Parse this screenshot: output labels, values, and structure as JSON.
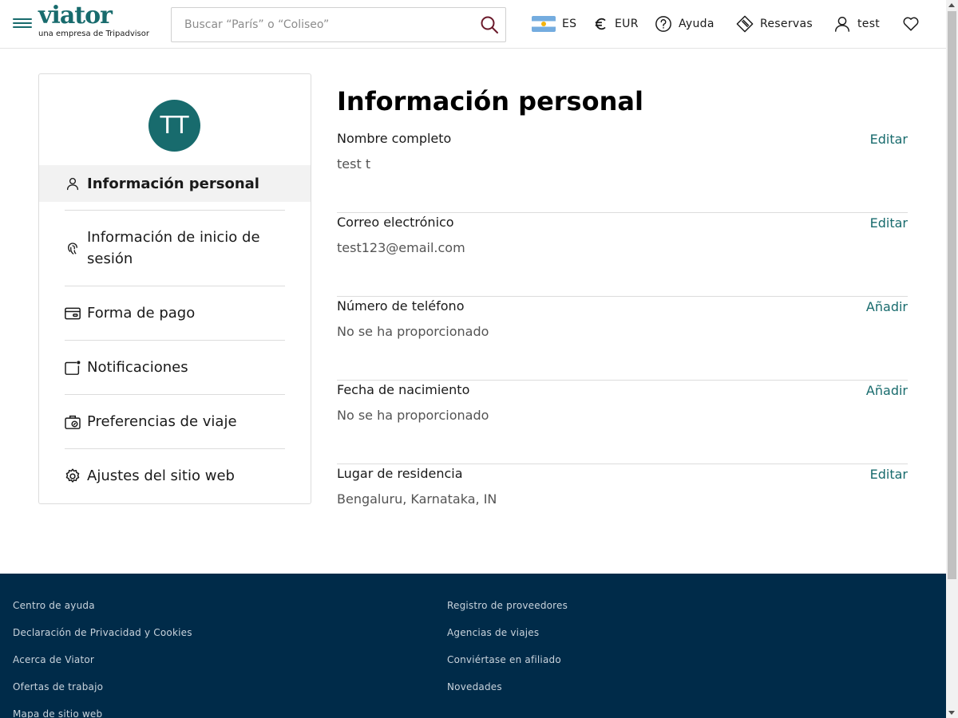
{
  "header": {
    "logo": "viator",
    "logo_sub": "una empresa de Tripadvisor",
    "search_placeholder": "Buscar “París” o “Coliseo”",
    "language": "ES",
    "currency": "EUR",
    "help": "Ayuda",
    "bookings": "Reservas",
    "user": "test"
  },
  "sidebar": {
    "avatar_initials": "TT",
    "items": [
      {
        "label": "Información personal",
        "icon": "person-icon"
      },
      {
        "label": "Información de inicio de sesión",
        "icon": "fingerprint-icon"
      },
      {
        "label": "Forma de pago",
        "icon": "credit-card-icon"
      },
      {
        "label": "Notificaciones",
        "icon": "notification-icon"
      },
      {
        "label": "Preferencias de viaje",
        "icon": "luggage-icon"
      },
      {
        "label": "Ajustes del sitio web",
        "icon": "gear-icon"
      }
    ]
  },
  "main": {
    "title": "Información personal",
    "fields": [
      {
        "label": "Nombre completo",
        "value": "test t",
        "action": "Editar"
      },
      {
        "label": "Correo electrónico",
        "value": "test123@email.com",
        "action": "Editar"
      },
      {
        "label": "Número de teléfono",
        "value": "No se ha proporcionado",
        "action": "Añadir"
      },
      {
        "label": "Fecha de nacimiento",
        "value": "No se ha proporcionado",
        "action": "Añadir"
      },
      {
        "label": "Lugar de residencia",
        "value": "Bengaluru, Karnataka, IN",
        "action": "Editar"
      }
    ]
  },
  "footer": {
    "col1": [
      "Centro de ayuda",
      "Declaración de Privacidad y Cookies",
      "Acerca de Viator",
      "Ofertas de trabajo",
      "Mapa de sitio web"
    ],
    "col2": [
      "Registro de proveedores",
      "Agencias de viajes",
      "Conviértase en afiliado",
      "Novedades"
    ]
  },
  "colors": {
    "brand": "#186b6d",
    "footer_bg": "#002b49",
    "search_icon": "#6b1a2b"
  }
}
